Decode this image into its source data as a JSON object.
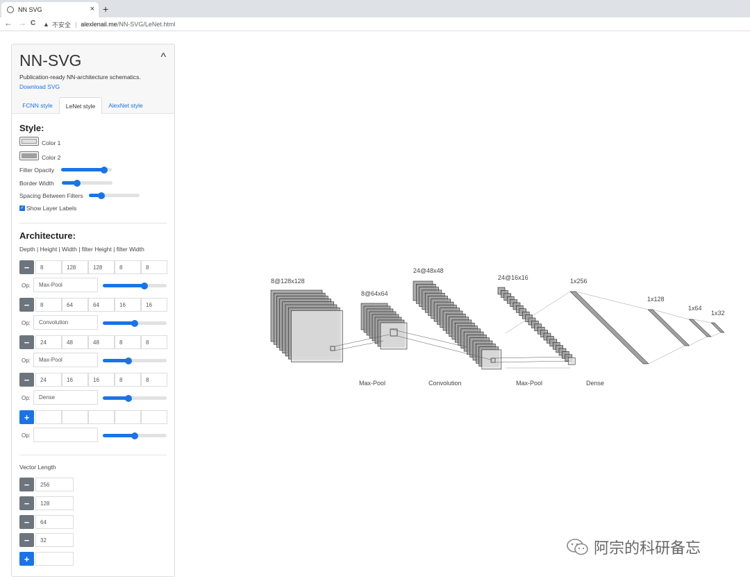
{
  "browser": {
    "tab_title": "NN SVG",
    "tab_close": "×",
    "new_tab": "+",
    "back": "←",
    "forward": "→",
    "reload": "C",
    "insecure_label": "不安全",
    "separator": "|",
    "url_host": "alexlenail.me",
    "url_path": "/NN-SVG/LeNet.html"
  },
  "panel": {
    "title": "NN-SVG",
    "collapse_icon": "^",
    "subtitle": "Publication-ready NN-architecture schematics.",
    "download": "Download SVG",
    "tabs": [
      {
        "label": "FCNN style",
        "active": false
      },
      {
        "label": "LeNet style",
        "active": true
      },
      {
        "label": "AlexNet style",
        "active": false
      }
    ],
    "style": {
      "heading": "Style:",
      "color1_label": "Color 1",
      "color1": "#e0e0e0",
      "color2_label": "Color 2",
      "color2": "#a0a0a0",
      "filter_opacity_label": "Filter Opacity",
      "filter_opacity": 0.85,
      "border_width_label": "Border Width",
      "border_width": 0.3,
      "spacing_label": "Spacing Between Filters",
      "spacing": 0.25,
      "show_labels_label": "Show Layer Labels",
      "show_labels": true
    },
    "architecture": {
      "heading": "Architecture:",
      "columns_label": "Depth | Height | Width | filter Height | filter Width",
      "op_prefix": "Op:",
      "layers": [
        {
          "values": [
            "8",
            "128",
            "128",
            "8",
            "8"
          ],
          "op": "Max-Pool",
          "op_level": 0.65
        },
        {
          "values": [
            "8",
            "64",
            "64",
            "16",
            "16"
          ],
          "op": "Convolution",
          "op_level": 0.5
        },
        {
          "values": [
            "24",
            "48",
            "48",
            "8",
            "8"
          ],
          "op": "Max-Pool",
          "op_level": 0.4
        },
        {
          "values": [
            "24",
            "16",
            "16",
            "8",
            "8"
          ],
          "op": "Dense",
          "op_level": 0.4
        }
      ],
      "new_op_level": 0.5,
      "minus": "−",
      "plus": "+"
    },
    "vector": {
      "label": "Vector Length",
      "values": [
        "256",
        "128",
        "64",
        "32"
      ]
    }
  },
  "diagram": {
    "layer_labels": [
      "8@128x128",
      "8@64x64",
      "24@48x48",
      "24@16x16",
      "1x256",
      "1x128",
      "1x64",
      "1x32"
    ],
    "op_labels": [
      "Max-Pool",
      "Convolution",
      "Max-Pool",
      "Dense"
    ]
  },
  "watermark": "阿宗的科研备忘"
}
